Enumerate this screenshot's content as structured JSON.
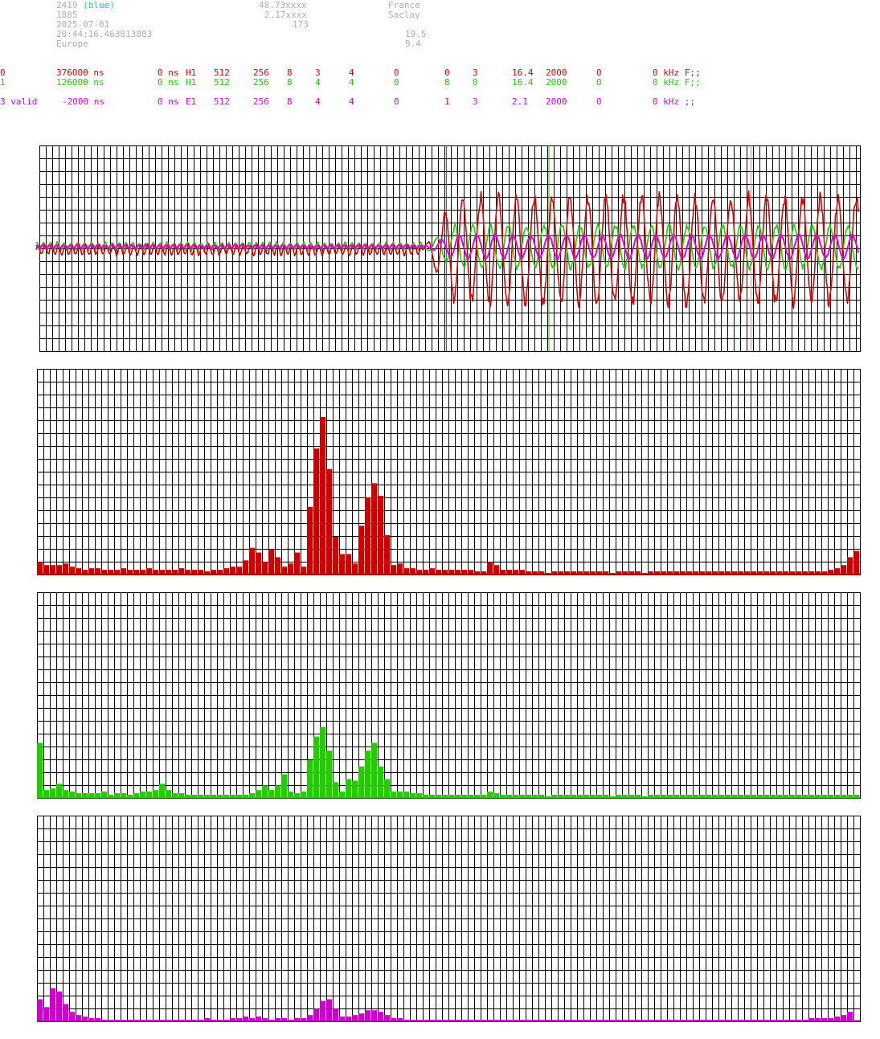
{
  "header": {
    "station_id": "2419",
    "station_color_label": "(blue)",
    "station_sub": "1885",
    "date": "2025-07-01",
    "time": "20:44:16.463813803",
    "region": "Europe",
    "lat": "48.73xxxx",
    "lon": "2.17xxxx",
    "alt": "173",
    "country": "France",
    "city": "Saclay",
    "val_a": "19.5",
    "val_b": "9.4"
  },
  "rows": [
    {
      "id": "0",
      "delay": "376000 ns",
      "offset": "0 ns",
      "type": "H1",
      "c1": "512",
      "c2": "256",
      "c3": "8",
      "c4": "3",
      "c5": "4",
      "c6": "0",
      "c7": "0",
      "c8": "3",
      "c9": "16.4",
      "c10": "2000",
      "c11": "0",
      "tail": "0 kHz F;;",
      "color": "#e00000"
    },
    {
      "id": "1",
      "delay": "126000 ns",
      "offset": "0 ns",
      "type": "H1",
      "c1": "512",
      "c2": "256",
      "c3": "8",
      "c4": "4",
      "c5": "4",
      "c6": "0",
      "c7": "8",
      "c8": "0",
      "c9": "16.4",
      "c10": "2000",
      "c11": "0",
      "tail": "0 kHz F;;",
      "color": "#22cc00"
    },
    {
      "id": "3 valid",
      "delay": "-2000 ns",
      "offset": "0 ns",
      "type": "E1",
      "c1": "512",
      "c2": "256",
      "c3": "8",
      "c4": "4",
      "c5": "4",
      "c6": "0",
      "c7": "1",
      "c8": "3",
      "c9": "2.1",
      "c10": "2000",
      "c11": "0",
      "tail": "0 kHz ;;",
      "color": "#e000e0"
    }
  ],
  "chart_data": [
    {
      "type": "line",
      "title": "",
      "xlim": [
        0,
        1
      ],
      "ylim": [
        -1,
        1
      ],
      "grid": true,
      "markers": [
        {
          "x": 0.496,
          "color": "#a020a0"
        },
        {
          "x": 0.621,
          "color": "#22cc00"
        },
        {
          "x": 0.867,
          "color": "#ff8080"
        }
      ],
      "series": [
        {
          "color": "#e00000",
          "baseline": -0.03,
          "pre_amp": 0.06,
          "onset": 0.47,
          "post_amp": 0.55,
          "cycles": 46
        },
        {
          "color": "#22cc00",
          "baseline": 0.0,
          "pre_amp": 0.05,
          "onset": 0.47,
          "post_amp": 0.22,
          "cycles": 46
        },
        {
          "color": "#e000e0",
          "baseline": 0.0,
          "pre_amp": 0.02,
          "onset": 0.47,
          "post_amp": 0.12,
          "cycles": 46
        }
      ]
    },
    {
      "type": "bar",
      "color": "#cc0000",
      "ylim": [
        0,
        1
      ],
      "grid": true,
      "bins": 128,
      "values": [
        0.08,
        0.06,
        0.06,
        0.06,
        0.07,
        0.05,
        0.04,
        0.03,
        0.04,
        0.04,
        0.03,
        0.03,
        0.03,
        0.04,
        0.03,
        0.03,
        0.03,
        0.04,
        0.03,
        0.03,
        0.03,
        0.03,
        0.04,
        0.03,
        0.03,
        0.03,
        0.02,
        0.03,
        0.03,
        0.04,
        0.05,
        0.05,
        0.09,
        0.17,
        0.14,
        0.08,
        0.16,
        0.11,
        0.05,
        0.07,
        0.14,
        0.05,
        0.43,
        0.8,
        1.0,
        0.67,
        0.24,
        0.13,
        0.13,
        0.07,
        0.31,
        0.49,
        0.58,
        0.5,
        0.25,
        0.06,
        0.07,
        0.04,
        0.04,
        0.03,
        0.03,
        0.04,
        0.03,
        0.03,
        0.03,
        0.03,
        0.03,
        0.03,
        0.02,
        0.02,
        0.08,
        0.06,
        0.03,
        0.03,
        0.03,
        0.03,
        0.02,
        0.02,
        0.02,
        0.01,
        0.02,
        0.02,
        0.02,
        0.02,
        0.02,
        0.02,
        0.02,
        0.02,
        0.02,
        0.01,
        0.02,
        0.02,
        0.02,
        0.02,
        0.01,
        0.02,
        0.02,
        0.02,
        0.02,
        0.02,
        0.02,
        0.02,
        0.02,
        0.02,
        0.02,
        0.02,
        0.02,
        0.02,
        0.02,
        0.02,
        0.02,
        0.02,
        0.02,
        0.02,
        0.02,
        0.02,
        0.02,
        0.02,
        0.02,
        0.02,
        0.02,
        0.02,
        0.02,
        0.03,
        0.04,
        0.06,
        0.11,
        0.15
      ]
    },
    {
      "type": "bar",
      "color": "#22cc00",
      "ylim": [
        0,
        1
      ],
      "grid": true,
      "bins": 128,
      "values": [
        0.35,
        0.05,
        0.06,
        0.09,
        0.05,
        0.04,
        0.03,
        0.03,
        0.03,
        0.03,
        0.04,
        0.02,
        0.03,
        0.03,
        0.02,
        0.03,
        0.04,
        0.04,
        0.05,
        0.09,
        0.05,
        0.03,
        0.03,
        0.02,
        0.02,
        0.02,
        0.02,
        0.02,
        0.02,
        0.02,
        0.02,
        0.02,
        0.02,
        0.03,
        0.05,
        0.08,
        0.05,
        0.08,
        0.15,
        0.04,
        0.03,
        0.04,
        0.24,
        0.39,
        0.45,
        0.3,
        0.1,
        0.04,
        0.12,
        0.11,
        0.2,
        0.3,
        0.35,
        0.2,
        0.12,
        0.04,
        0.04,
        0.04,
        0.03,
        0.03,
        0.02,
        0.02,
        0.02,
        0.02,
        0.02,
        0.02,
        0.02,
        0.02,
        0.02,
        0.02,
        0.04,
        0.03,
        0.02,
        0.02,
        0.02,
        0.02,
        0.02,
        0.02,
        0.02,
        0.01,
        0.02,
        0.02,
        0.02,
        0.02,
        0.02,
        0.02,
        0.02,
        0.02,
        0.02,
        0.01,
        0.02,
        0.02,
        0.02,
        0.02,
        0.01,
        0.02,
        0.02,
        0.02,
        0.02,
        0.02,
        0.02,
        0.02,
        0.02,
        0.02,
        0.02,
        0.02,
        0.02,
        0.02,
        0.02,
        0.02,
        0.02,
        0.02,
        0.02,
        0.02,
        0.02,
        0.02,
        0.02,
        0.02,
        0.02,
        0.02,
        0.02,
        0.02,
        0.02,
        0.02,
        0.02,
        0.02,
        0.02,
        0.02
      ]
    },
    {
      "type": "bar",
      "color": "#cc00cc",
      "ylim": [
        0,
        1
      ],
      "grid": true,
      "bins": 128,
      "values": [
        0.14,
        0.09,
        0.21,
        0.19,
        0.11,
        0.06,
        0.04,
        0.03,
        0.02,
        0.02,
        0.01,
        0.01,
        0.01,
        0.01,
        0.01,
        0.01,
        0.01,
        0.01,
        0.01,
        0.01,
        0.01,
        0.01,
        0.01,
        0.01,
        0.01,
        0.01,
        0.02,
        0.01,
        0.01,
        0.01,
        0.02,
        0.02,
        0.03,
        0.02,
        0.03,
        0.02,
        0.01,
        0.02,
        0.02,
        0.01,
        0.02,
        0.02,
        0.04,
        0.08,
        0.13,
        0.14,
        0.08,
        0.03,
        0.03,
        0.04,
        0.05,
        0.07,
        0.07,
        0.06,
        0.04,
        0.02,
        0.02,
        0.01,
        0.01,
        0.01,
        0.01,
        0.01,
        0.01,
        0.01,
        0.01,
        0.01,
        0.01,
        0.01,
        0.01,
        0.01,
        0.01,
        0.01,
        0.01,
        0.01,
        0.01,
        0.01,
        0.01,
        0.01,
        0.01,
        0.01,
        0.01,
        0.01,
        0.01,
        0.01,
        0.01,
        0.01,
        0.01,
        0.01,
        0.01,
        0.01,
        0.01,
        0.01,
        0.01,
        0.01,
        0.01,
        0.01,
        0.01,
        0.01,
        0.01,
        0.01,
        0.01,
        0.01,
        0.01,
        0.01,
        0.01,
        0.01,
        0.01,
        0.01,
        0.01,
        0.01,
        0.01,
        0.01,
        0.01,
        0.01,
        0.01,
        0.01,
        0.01,
        0.01,
        0.01,
        0.01,
        0.02,
        0.02,
        0.02,
        0.02,
        0.03,
        0.04,
        0.06
      ]
    }
  ]
}
